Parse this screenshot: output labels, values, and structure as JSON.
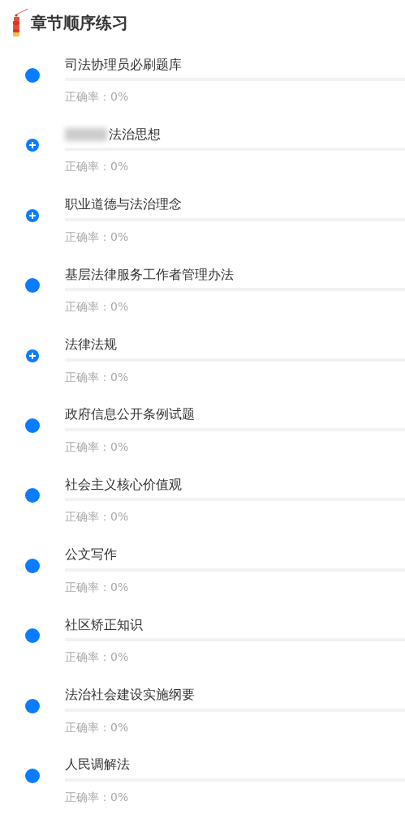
{
  "header": {
    "title": "章节顺序练习"
  },
  "chapters": [
    {
      "kind": "dot",
      "title": "司法协理员必刷题库",
      "accuracy": "正确率：0%"
    },
    {
      "kind": "expandable",
      "redacted_prefix": true,
      "title": "法治思想",
      "accuracy": "正确率：0%"
    },
    {
      "kind": "expandable",
      "title": "职业道德与法治理念",
      "accuracy": "正确率：0%"
    },
    {
      "kind": "dot",
      "title": "基层法律服务工作者管理办法",
      "accuracy": "正确率：0%"
    },
    {
      "kind": "expandable",
      "title": "法律法规",
      "accuracy": "正确率：0%"
    },
    {
      "kind": "dot",
      "title": "政府信息公开条例试题",
      "accuracy": "正确率：0%"
    },
    {
      "kind": "dot",
      "title": "社会主义核心价值观",
      "accuracy": "正确率：0%"
    },
    {
      "kind": "dot",
      "title": "公文写作",
      "accuracy": "正确率：0%"
    },
    {
      "kind": "dot",
      "title": "社区矫正知识",
      "accuracy": "正确率：0%"
    },
    {
      "kind": "dot",
      "title": "法治社会建设实施纲要",
      "accuracy": "正确率：0%"
    },
    {
      "kind": "dot",
      "title": "人民调解法",
      "accuracy": "正确率：0%"
    }
  ]
}
